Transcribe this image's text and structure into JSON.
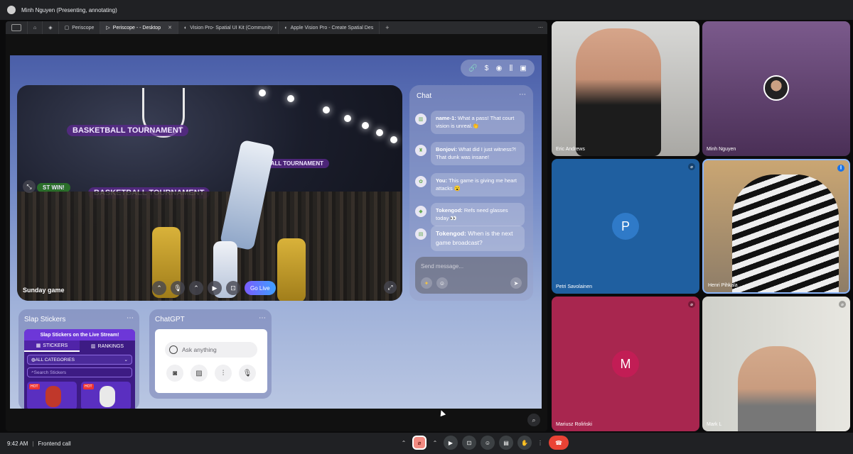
{
  "meeting": {
    "presenter_label": "Minh Nguyen (Presenting, annotating)",
    "time": "9:42 AM",
    "meeting_name": "Frontend call"
  },
  "browser": {
    "tabs": [
      {
        "label": "Periscope"
      },
      {
        "label": "Periscope - - Desktop",
        "active": true
      },
      {
        "label": "Vision Pro- Spatial UI Kit (Community"
      },
      {
        "label": "Apple Vision Pro - Create Spatial Des"
      }
    ],
    "new_tab": "+",
    "menu": "⋯"
  },
  "app": {
    "toolbar": {
      "icons": [
        "link-icon",
        "dollar-icon",
        "record-icon",
        "equalizer-icon",
        "sidebar-icon"
      ],
      "dollar": "$"
    },
    "video": {
      "label": "Sunday game",
      "go_live": "Go Live",
      "banner_1": "BASKETBALL TOURNAMENT",
      "banner_2": "BASKETBALL TOURNAMENT",
      "banner_3": "BASKETBALL TOURNAMENT",
      "banner_4": "ST WIN!"
    },
    "chat": {
      "title": "Chat",
      "menu": "⋯",
      "messages": [
        {
          "user": "name-1:",
          "text": "What a pass! That court vision is unreal.👏"
        },
        {
          "user": "Bonjovi:",
          "text": "What did I just witness?! That dunk was insane!"
        },
        {
          "user": "You:",
          "text": "This game is giving me heart attacks 😮"
        },
        {
          "user": "Tokengod:",
          "text": "Refs need glasses today 👀"
        },
        {
          "user": "Tokengod:",
          "text": "When is the next game broadcast?"
        }
      ],
      "composer_placeholder": "Send message..."
    },
    "stickers": {
      "title": "Slap Stickers",
      "menu": "⋯",
      "banner": "Slap Stickers on the Live Stream!",
      "tab_stickers": "STICKERS",
      "tab_rankings": "RANKINGS",
      "category": "ALL CATEGORIES",
      "search_placeholder": "Search Stickers",
      "hot": "HOT"
    },
    "chatgpt": {
      "title": "ChatGPT",
      "menu": "⋯",
      "input_placeholder": "Ask anything"
    }
  },
  "participants": [
    {
      "name": "Eric Andrews"
    },
    {
      "name": "Minh Nguyen"
    },
    {
      "name": "Petri Savolainen",
      "initial": "P",
      "color": "#1d6fb8"
    },
    {
      "name": "Henri Pihkala"
    },
    {
      "name": "Mariusz Roliński",
      "initial": "M",
      "color": "#b0124a"
    },
    {
      "name": "Mark L"
    }
  ],
  "colors": {
    "tile_blue": "#1f5fa0",
    "tile_pink": "#a8264f",
    "tile_purple": "#6e4a80",
    "end_call": "#ea4335"
  }
}
